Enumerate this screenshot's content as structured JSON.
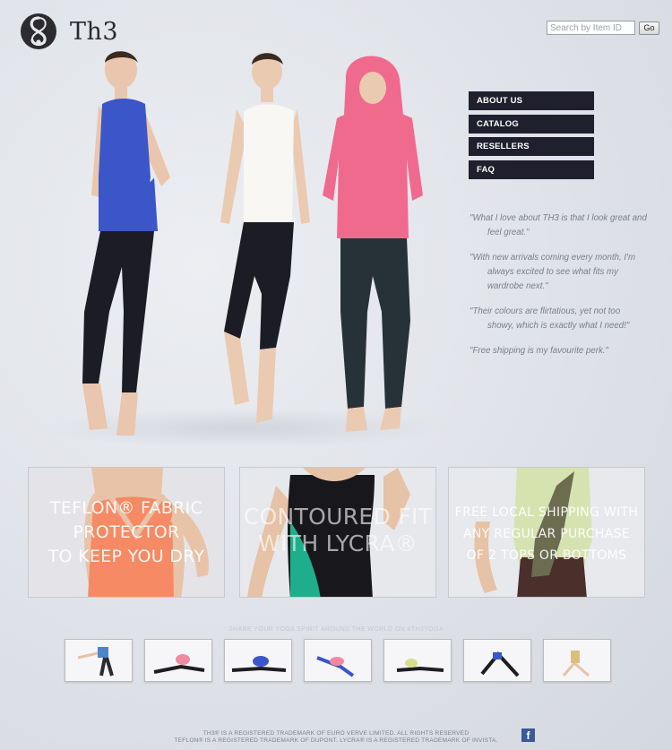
{
  "brand": {
    "name": "Th3",
    "logo_icon": "swirl-monogram-icon"
  },
  "search": {
    "placeholder": "Search by Item ID",
    "button_label": "Go"
  },
  "nav": {
    "items": [
      {
        "label": "ABOUT US"
      },
      {
        "label": "CATALOG"
      },
      {
        "label": "RESELLERS"
      },
      {
        "label": "FAQ"
      }
    ]
  },
  "quotes": [
    "\"What I love about TH3 is that I look great and feel great.\"",
    "\"With new arrivals coming every month, I'm always excited to see what fits my wardrobe next.\"",
    "\"Their colours are flirtatious, yet not too showy, which is exactly what I need!\"",
    "\"Free shipping is my favourite perk.\""
  ],
  "panels": [
    {
      "lines": [
        "TEFLON® FABRIC",
        "PROTECTOR",
        "TO KEEP YOU DRY"
      ]
    },
    {
      "lines": [
        "CONTOURED FIT",
        "WITH LYCRA®"
      ]
    },
    {
      "lines": [
        "FREE LOCAL SHIPPING WITH",
        "ANY REGULAR PURCHASE",
        "OF 2 TOPS OR BOTTOMS"
      ]
    }
  ],
  "share": {
    "text": "SHARE YOUR YOGA SPIRIT AROUND THE WORLD ON #TH3YOGA"
  },
  "footer": {
    "line1": "TH3® IS A REGISTERED TRADEMARK OF EURO VERVE LIMITED. ALL RIGHTS RESERVED",
    "line2": "TEFLON® IS A REGISTERED TRADEMARK OF DUPONT. LYCRA® IS A REGISTERED TRADEMARK OF INVISTA.",
    "social_icon": "facebook-icon"
  },
  "colors": {
    "nav_bg": "#1f1f2d",
    "accent_blue": "#3a56c8",
    "accent_pink": "#f06a8e",
    "accent_orange": "#f58a64",
    "accent_teal": "#1fae8c"
  }
}
